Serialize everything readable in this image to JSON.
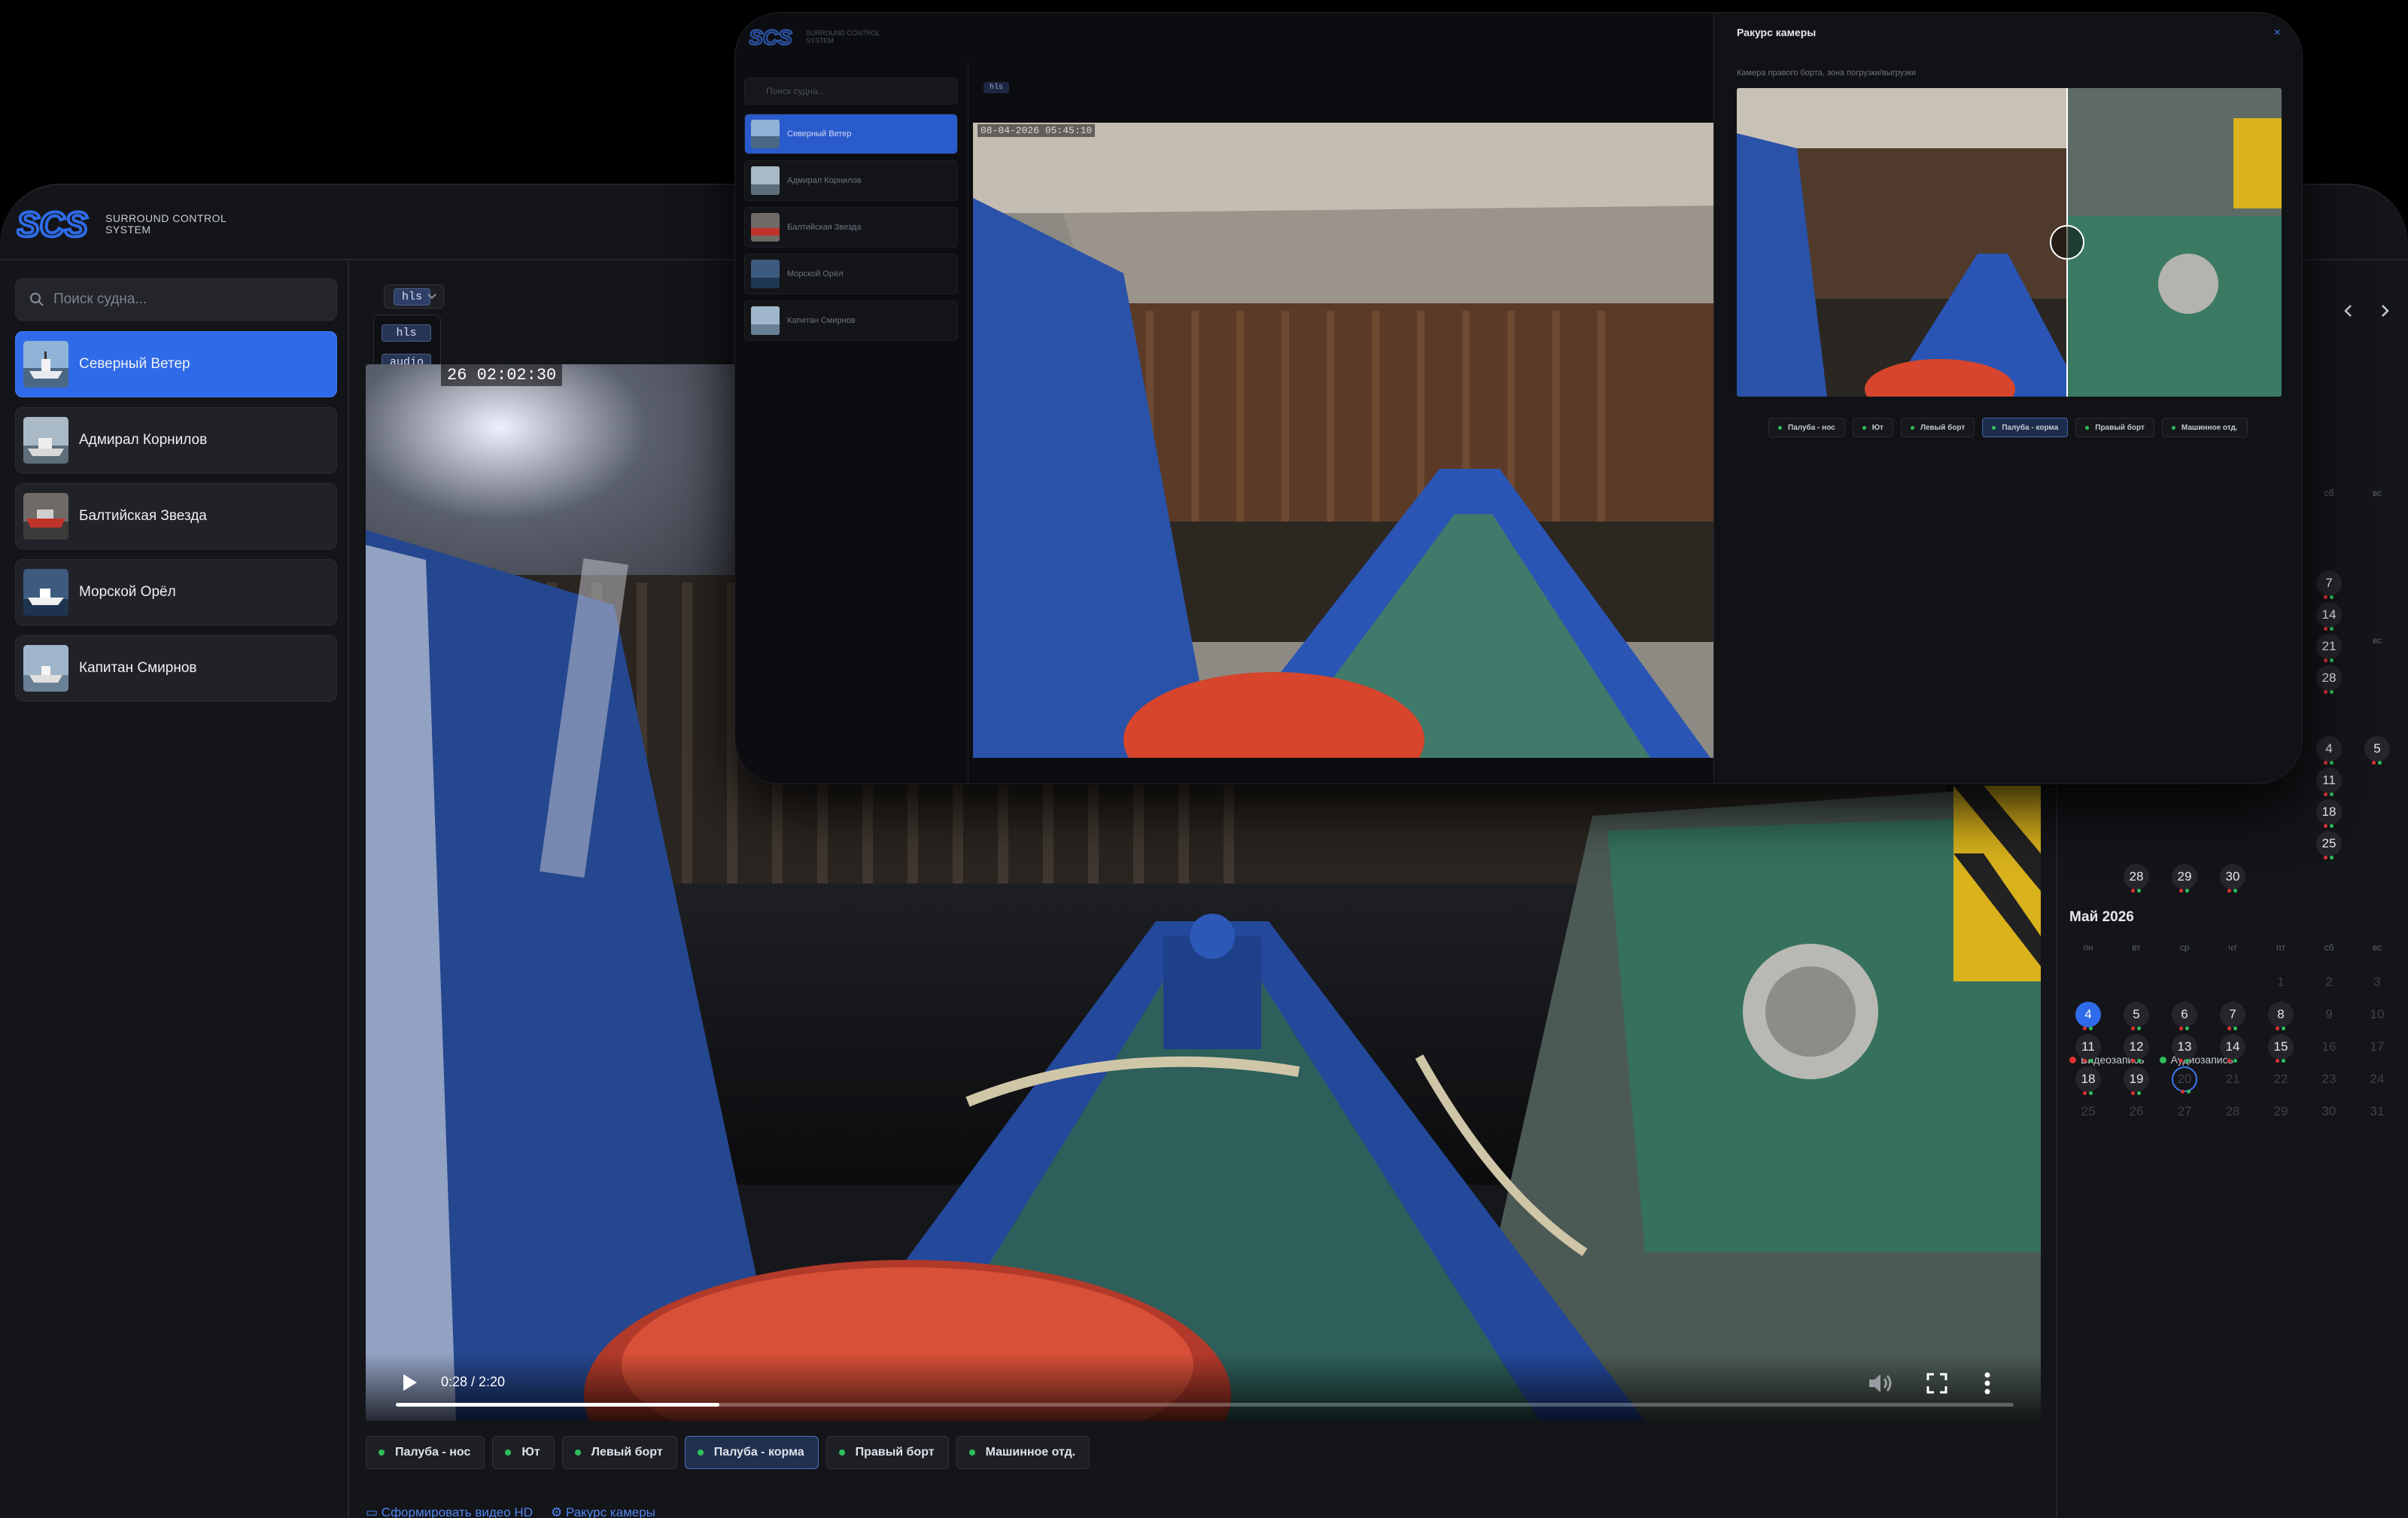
{
  "app": {
    "logo_mark": "SCS",
    "logo_line1": "SURROUND CONTROL",
    "logo_line2": "SYSTEM"
  },
  "sidebar": {
    "search_placeholder": "Поиск судна...",
    "vessels": [
      {
        "name": "Северный Ветер",
        "active": true
      },
      {
        "name": "Адмирал Корнилов",
        "active": false
      },
      {
        "name": "Балтийская Звезда",
        "active": false
      },
      {
        "name": "Морской Орёл",
        "active": false
      },
      {
        "name": "Капитан Смирнов",
        "active": false
      }
    ]
  },
  "player": {
    "stream_selected": "hls",
    "stream_options": [
      "hls",
      "audio"
    ],
    "osd_timestamp": "26 02:02:30",
    "time": "0:28 / 2:20",
    "progress": 0.2
  },
  "cameras": [
    {
      "label": "Палуба - нос",
      "active": false
    },
    {
      "label": "Ют",
      "active": false
    },
    {
      "label": "Левый борт",
      "active": false
    },
    {
      "label": "Палуба - корма",
      "active": true
    },
    {
      "label": "Правый борт",
      "active": false
    },
    {
      "label": "Машинное отд.",
      "active": false
    }
  ],
  "actions": {
    "generate_video": "Сформировать видео HD",
    "camera_angle": "Ракурс камеры"
  },
  "calendar": {
    "weekdays": [
      "пн",
      "вт",
      "ср",
      "чт",
      "пт",
      "сб",
      "вс"
    ],
    "month_title": "Май 2026",
    "legend_video": "Видеозапись",
    "legend_audio": "Аудиозапись",
    "upper_days": [
      "7",
      "14",
      "21",
      "28",
      "4",
      "5",
      "11",
      "18",
      "25",
      "28",
      "29",
      "30"
    ],
    "may_days": {
      "row1": [
        "",
        "",
        "",
        "",
        "1",
        "2",
        "3"
      ],
      "row2": [
        "4",
        "5",
        "6",
        "7",
        "8",
        "9",
        "10"
      ],
      "row3": [
        "11",
        "12",
        "13",
        "14",
        "15",
        "16",
        "17"
      ],
      "row4": [
        "18",
        "19",
        "20",
        "21",
        "22",
        "23",
        "24"
      ],
      "row5": [
        "25",
        "26",
        "27",
        "28",
        "29",
        "30",
        "31"
      ]
    },
    "colors": {
      "video": "#e0332f",
      "audio": "#2fbf5a",
      "accent": "#2f6be8"
    }
  },
  "front": {
    "osd_timestamp": "08-04-2026 05:45:10",
    "stream": "hls",
    "search_placeholder": "Поиск судна...",
    "modal_title": "Ракурс камеры",
    "modal_close": "×",
    "modal_subtitle": "Камера правого борта, зона погрузки/выгрузки"
  }
}
